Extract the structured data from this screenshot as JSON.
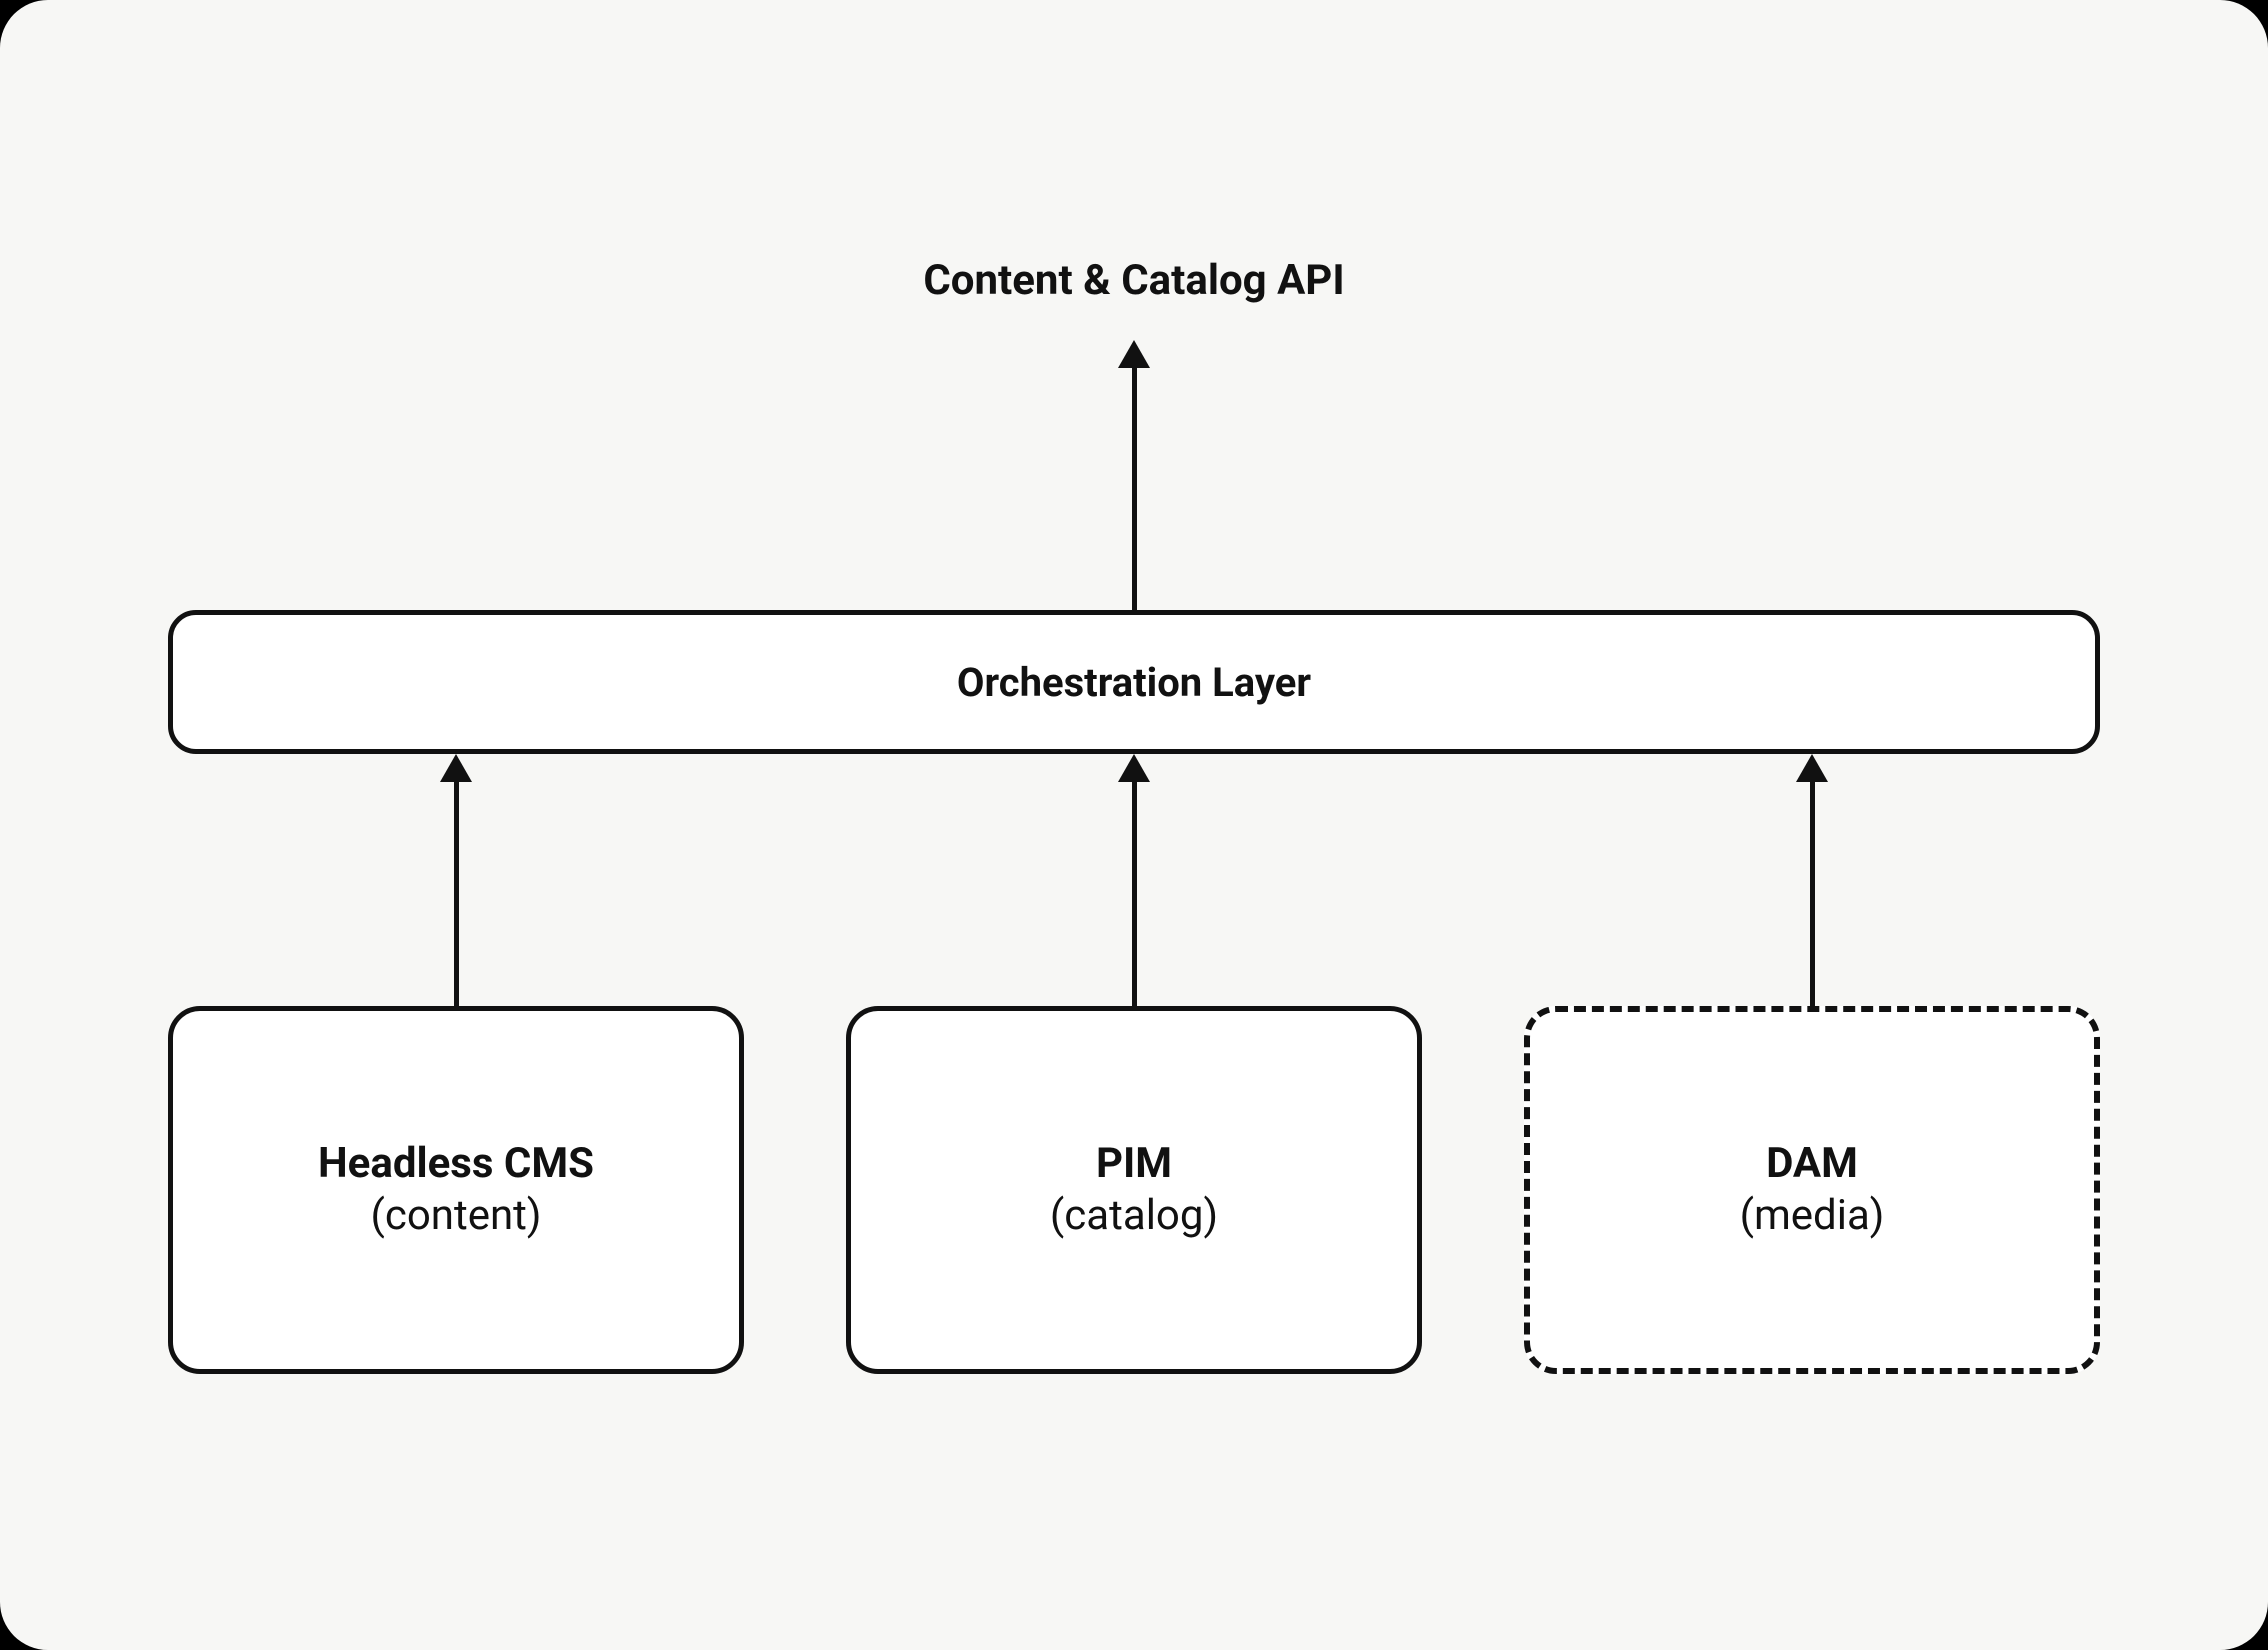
{
  "diagram": {
    "title": "Content & Catalog API",
    "orchestration": {
      "label": "Orchestration Layer"
    },
    "sources": {
      "cms": {
        "title": "Headless CMS",
        "subtitle": "(content)",
        "style": "solid"
      },
      "pim": {
        "title": "PIM",
        "subtitle": "(catalog)",
        "style": "solid"
      },
      "dam": {
        "title": "DAM",
        "subtitle": "(media)",
        "style": "dashed"
      }
    }
  }
}
